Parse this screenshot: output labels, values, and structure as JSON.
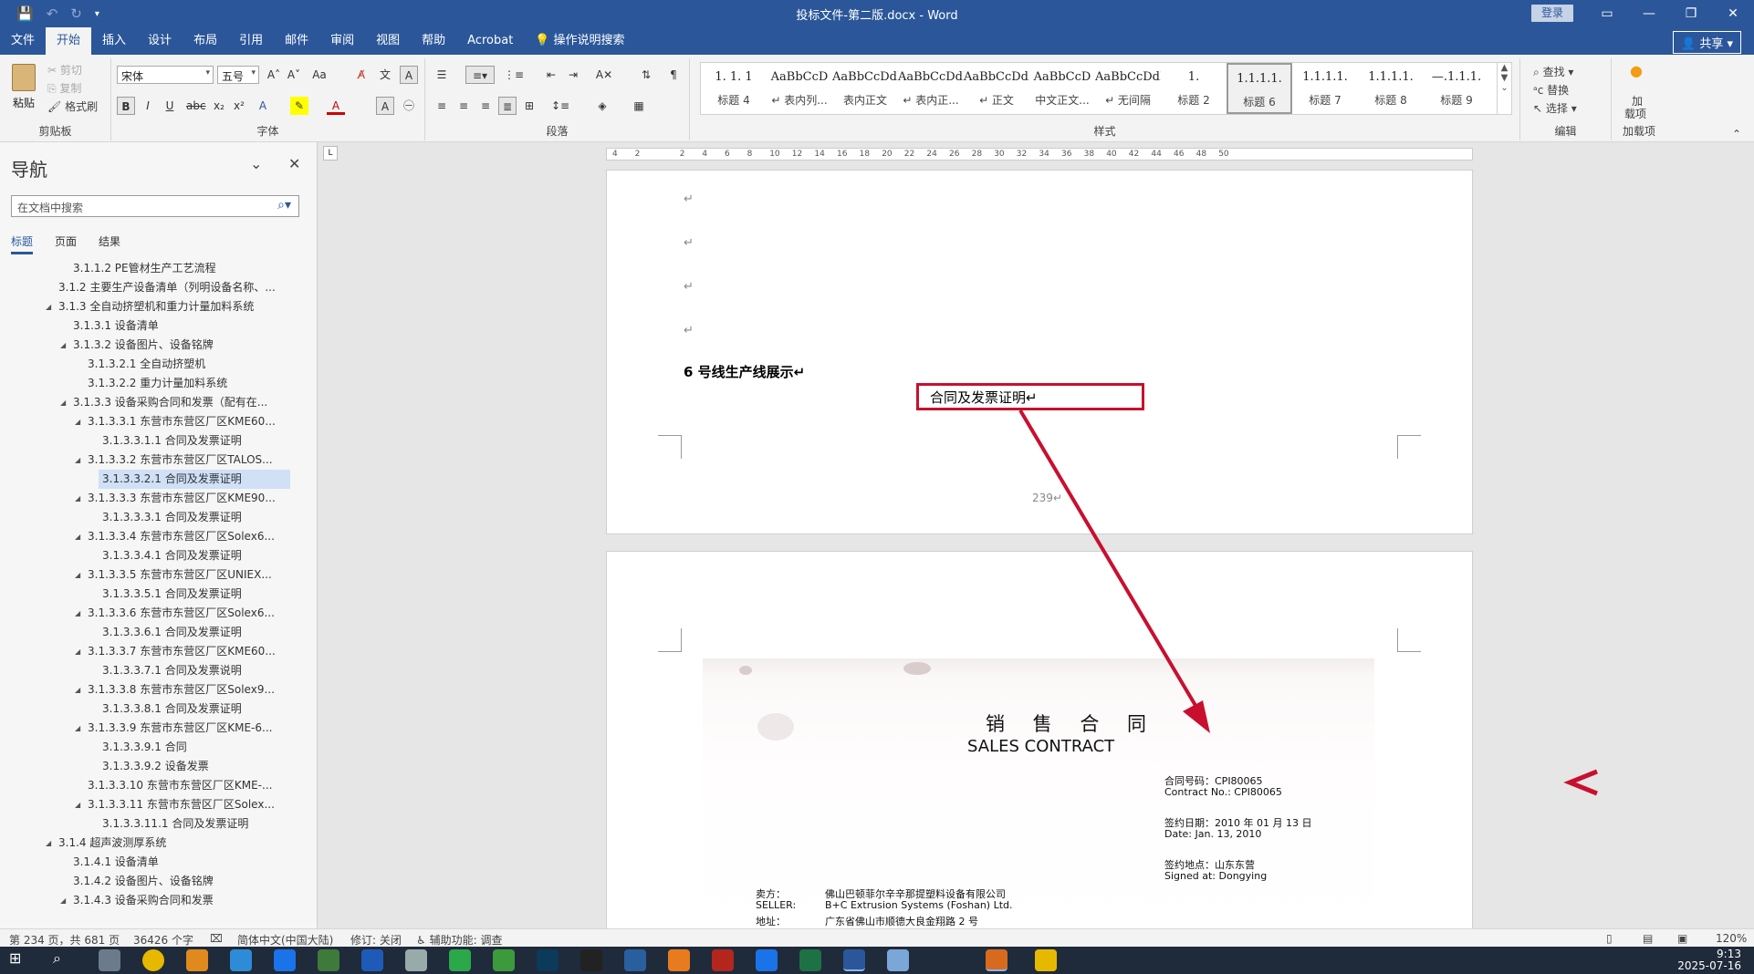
{
  "window": {
    "title": "投标文件-第二版.docx - Word",
    "login": "登录",
    "share": "共享"
  },
  "tabs": [
    {
      "label": "文件"
    },
    {
      "label": "开始"
    },
    {
      "label": "插入"
    },
    {
      "label": "设计"
    },
    {
      "label": "布局"
    },
    {
      "label": "引用"
    },
    {
      "label": "邮件"
    },
    {
      "label": "审阅"
    },
    {
      "label": "视图"
    },
    {
      "label": "帮助"
    },
    {
      "label": "Acrobat"
    },
    {
      "label": "操作说明搜索"
    }
  ],
  "ribbon": {
    "clipboard": {
      "group": "剪贴板",
      "paste": "粘贴",
      "cut": "剪切",
      "copy": "复制",
      "format_painter": "格式刷"
    },
    "font": {
      "group": "字体",
      "name": "宋体",
      "size": "五号"
    },
    "paragraph": {
      "group": "段落"
    },
    "styles": {
      "group": "样式",
      "items": [
        {
          "preview": "1. 1. 1",
          "name": "标题 4"
        },
        {
          "preview": "AaBbCcD",
          "name": "↵ 表内列..."
        },
        {
          "preview": "AaBbCcDdI",
          "name": "表内正文"
        },
        {
          "preview": "AaBbCcDdI",
          "name": "↵ 表内正..."
        },
        {
          "preview": "AaBbCcDdI",
          "name": "↵ 正文"
        },
        {
          "preview": "AaBbCcD",
          "name": "中文正文..."
        },
        {
          "preview": "AaBbCcDdI",
          "name": "↵ 无间隔"
        },
        {
          "preview": "1.",
          "name": "标题 2"
        },
        {
          "preview": "1.1.1.1.",
          "name": "标题 6"
        },
        {
          "preview": "1.1.1.1.",
          "name": "标题 7"
        },
        {
          "preview": "1.1.1.1.",
          "name": "标题 8"
        },
        {
          "preview": "—.1.1.1.",
          "name": "标题 9"
        }
      ]
    },
    "editing": {
      "group": "编辑",
      "find": "查找",
      "replace": "替换",
      "select": "选择"
    },
    "addins": {
      "group": "加载项",
      "label1": "加",
      "label2": "载项"
    }
  },
  "nav": {
    "title": "导航",
    "search_placeholder": "在文档中搜索",
    "tabs": [
      "标题",
      "页面",
      "结果"
    ],
    "items": [
      {
        "text": "3.1.1.2 PE管材生产工艺流程",
        "level": 3,
        "tri": false,
        "sel": false
      },
      {
        "text": "3.1.2 主要生产设备清单（列明设备名称、...",
        "level": 2,
        "tri": false,
        "sel": false
      },
      {
        "text": "3.1.3 全自动挤塑机和重力计量加料系统",
        "level": 2,
        "tri": true,
        "sel": false
      },
      {
        "text": "3.1.3.1 设备清单",
        "level": 3,
        "tri": false,
        "sel": false
      },
      {
        "text": "3.1.3.2 设备图片、设备铭牌",
        "level": 3,
        "tri": true,
        "sel": false
      },
      {
        "text": "3.1.3.2.1 全自动挤塑机",
        "level": 4,
        "tri": false,
        "sel": false
      },
      {
        "text": "3.1.3.2.2 重力计量加料系统",
        "level": 4,
        "tri": false,
        "sel": false
      },
      {
        "text": "3.1.3.3 设备采购合同和发票（配有在...",
        "level": 3,
        "tri": true,
        "sel": false
      },
      {
        "text": "3.1.3.3.1 东营市东营区厂区KME60...",
        "level": 4,
        "tri": true,
        "sel": false
      },
      {
        "text": "3.1.3.3.1.1 合同及发票证明",
        "level": 5,
        "tri": false,
        "sel": false
      },
      {
        "text": "3.1.3.3.2 东营市东营区厂区TALOS...",
        "level": 4,
        "tri": true,
        "sel": false
      },
      {
        "text": "3.1.3.3.2.1 合同及发票证明",
        "level": 5,
        "tri": false,
        "sel": true
      },
      {
        "text": "3.1.3.3.3 东营市东营区厂区KME90...",
        "level": 4,
        "tri": true,
        "sel": false
      },
      {
        "text": "3.1.3.3.3.1 合同及发票证明",
        "level": 5,
        "tri": false,
        "sel": false
      },
      {
        "text": "3.1.3.3.4 东营市东营区厂区Solex6...",
        "level": 4,
        "tri": true,
        "sel": false
      },
      {
        "text": "3.1.3.3.4.1 合同及发票证明",
        "level": 5,
        "tri": false,
        "sel": false
      },
      {
        "text": "3.1.3.3.5 东营市东营区厂区UNIEX...",
        "level": 4,
        "tri": true,
        "sel": false
      },
      {
        "text": "3.1.3.3.5.1 合同及发票证明",
        "level": 5,
        "tri": false,
        "sel": false
      },
      {
        "text": "3.1.3.3.6 东营市东营区厂区Solex6...",
        "level": 4,
        "tri": true,
        "sel": false
      },
      {
        "text": "3.1.3.3.6.1 合同及发票证明",
        "level": 5,
        "tri": false,
        "sel": false
      },
      {
        "text": "3.1.3.3.7 东营市东营区厂区KME60...",
        "level": 4,
        "tri": true,
        "sel": false
      },
      {
        "text": "3.1.3.3.7.1 合同及发票说明",
        "level": 5,
        "tri": false,
        "sel": false
      },
      {
        "text": "3.1.3.3.8 东营市东营区厂区Solex9...",
        "level": 4,
        "tri": true,
        "sel": false
      },
      {
        "text": "3.1.3.3.8.1 合同及发票证明",
        "level": 5,
        "tri": false,
        "sel": false
      },
      {
        "text": "3.1.3.3.9 东营市东营区厂区KME-6...",
        "level": 4,
        "tri": true,
        "sel": false
      },
      {
        "text": "3.1.3.3.9.1 合同",
        "level": 5,
        "tri": false,
        "sel": false
      },
      {
        "text": "3.1.3.3.9.2 设备发票",
        "level": 5,
        "tri": false,
        "sel": false
      },
      {
        "text": "3.1.3.3.10 东营市东营区厂区KME-...",
        "level": 4,
        "tri": false,
        "sel": false
      },
      {
        "text": "3.1.3.3.11 东营市东营区厂区Solex...",
        "level": 4,
        "tri": true,
        "sel": false
      },
      {
        "text": "3.1.3.3.11.1 合同及发票证明",
        "level": 5,
        "tri": false,
        "sel": false
      },
      {
        "text": "3.1.4 超声波测厚系统",
        "level": 2,
        "tri": true,
        "sel": false
      },
      {
        "text": "3.1.4.1 设备清单",
        "level": 3,
        "tri": false,
        "sel": false
      },
      {
        "text": "3.1.4.2 设备图片、设备铭牌",
        "level": 3,
        "tri": false,
        "sel": false
      },
      {
        "text": "3.1.4.3 设备采购合同和发票",
        "level": 3,
        "tri": true,
        "sel": false
      }
    ]
  },
  "ruler": {
    "ticks": [
      "4",
      "2",
      "",
      "2",
      "4",
      "6",
      "8",
      "10",
      "12",
      "14",
      "16",
      "18",
      "20",
      "22",
      "24",
      "26",
      "28",
      "30",
      "32",
      "34",
      "36",
      "38",
      "40",
      "42",
      "44",
      "46",
      "48",
      "50"
    ]
  },
  "document": {
    "heading": "6 号线生产线展示↵",
    "caption": "合同及发票证明↵",
    "page_number": "239↵",
    "contract": {
      "title_cn": "销 售 合 同",
      "title_en": "SALES CONTRACT",
      "no_cn": "合同号码：CPI80065",
      "no_en": "Contract No.: CPI80065",
      "date_cn": "签约日期：2010 年 01 月 13 日",
      "date_en": "Date: Jan. 13, 2010",
      "place_cn": "签约地点：山东东营",
      "place_en": "Signed at: Dongying",
      "seller_label": "卖方：",
      "seller_cn": "佛山巴顿菲尔辛辛那提塑料设备有限公司",
      "seller_en_label": "SELLER:",
      "seller_en": "B+C Extrusion Systems (Foshan) Ltd.",
      "addr_label": "地址：",
      "addr": "广东省佛山市顺德大良金翔路 2 号"
    },
    "annotation_color": "#c8102e"
  },
  "status": {
    "page": "第 234 页，共 681 页",
    "words": "36426 个字",
    "lang": "简体中文(中国大陆)",
    "track": "修订: 关闭",
    "access": "辅助功能: 调查",
    "zoom": "120%"
  },
  "clock": {
    "time": "9:13",
    "date": "2025-07-16"
  }
}
